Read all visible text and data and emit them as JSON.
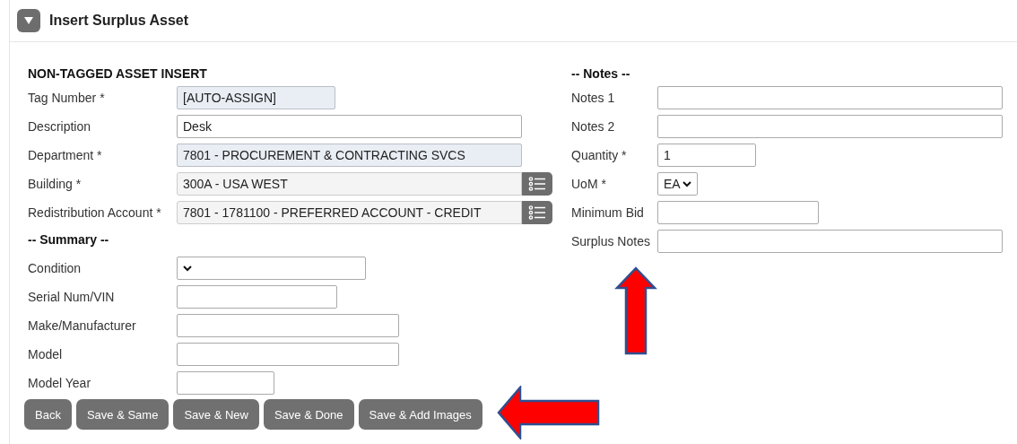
{
  "panel": {
    "title": "Insert Surplus Asset",
    "expanded": true
  },
  "left": {
    "heading": "NON-TAGGED ASSET INSERT",
    "fields": [
      {
        "label": "Tag Number *",
        "kind": "text",
        "value": "[AUTO-ASSIGN]",
        "readonly": true
      },
      {
        "label": "Description",
        "kind": "text",
        "value": "Desk",
        "readonly": false
      },
      {
        "label": "Department *",
        "kind": "text",
        "value": "7801 - PROCUREMENT & CONTRACTING SVCS",
        "readonly": true
      },
      {
        "label": "Building *",
        "kind": "lookup",
        "value": "300A - USA WEST"
      },
      {
        "label": "Redistribution Account *",
        "kind": "lookup",
        "value": "7801 - 1781100 - PREFERRED ACCOUNT - CREDIT"
      }
    ]
  },
  "summary": {
    "heading": "-- Summary --",
    "fields": [
      {
        "label": "Condition",
        "kind": "select"
      },
      {
        "label": "Serial Num/VIN",
        "kind": "text"
      },
      {
        "label": "Make/Manufacturer",
        "kind": "text"
      },
      {
        "label": "Model",
        "kind": "text"
      },
      {
        "label": "Model Year",
        "kind": "text"
      }
    ]
  },
  "notes": {
    "heading": "-- Notes --",
    "fields": [
      {
        "label": "Notes 1",
        "kind": "text"
      },
      {
        "label": "Notes 2",
        "kind": "text"
      },
      {
        "label": "Quantity *",
        "kind": "text",
        "value": "1"
      },
      {
        "label": "UoM *",
        "kind": "select",
        "value": "EA"
      },
      {
        "label": "Minimum Bid",
        "kind": "text"
      },
      {
        "label": "Surplus Notes",
        "kind": "text"
      }
    ]
  },
  "buttons": [
    "Back",
    "Save & Same",
    "Save & New",
    "Save & Done",
    "Save & Add Images"
  ],
  "callout_arrows": [
    {
      "kind": "up"
    },
    {
      "kind": "left"
    }
  ]
}
